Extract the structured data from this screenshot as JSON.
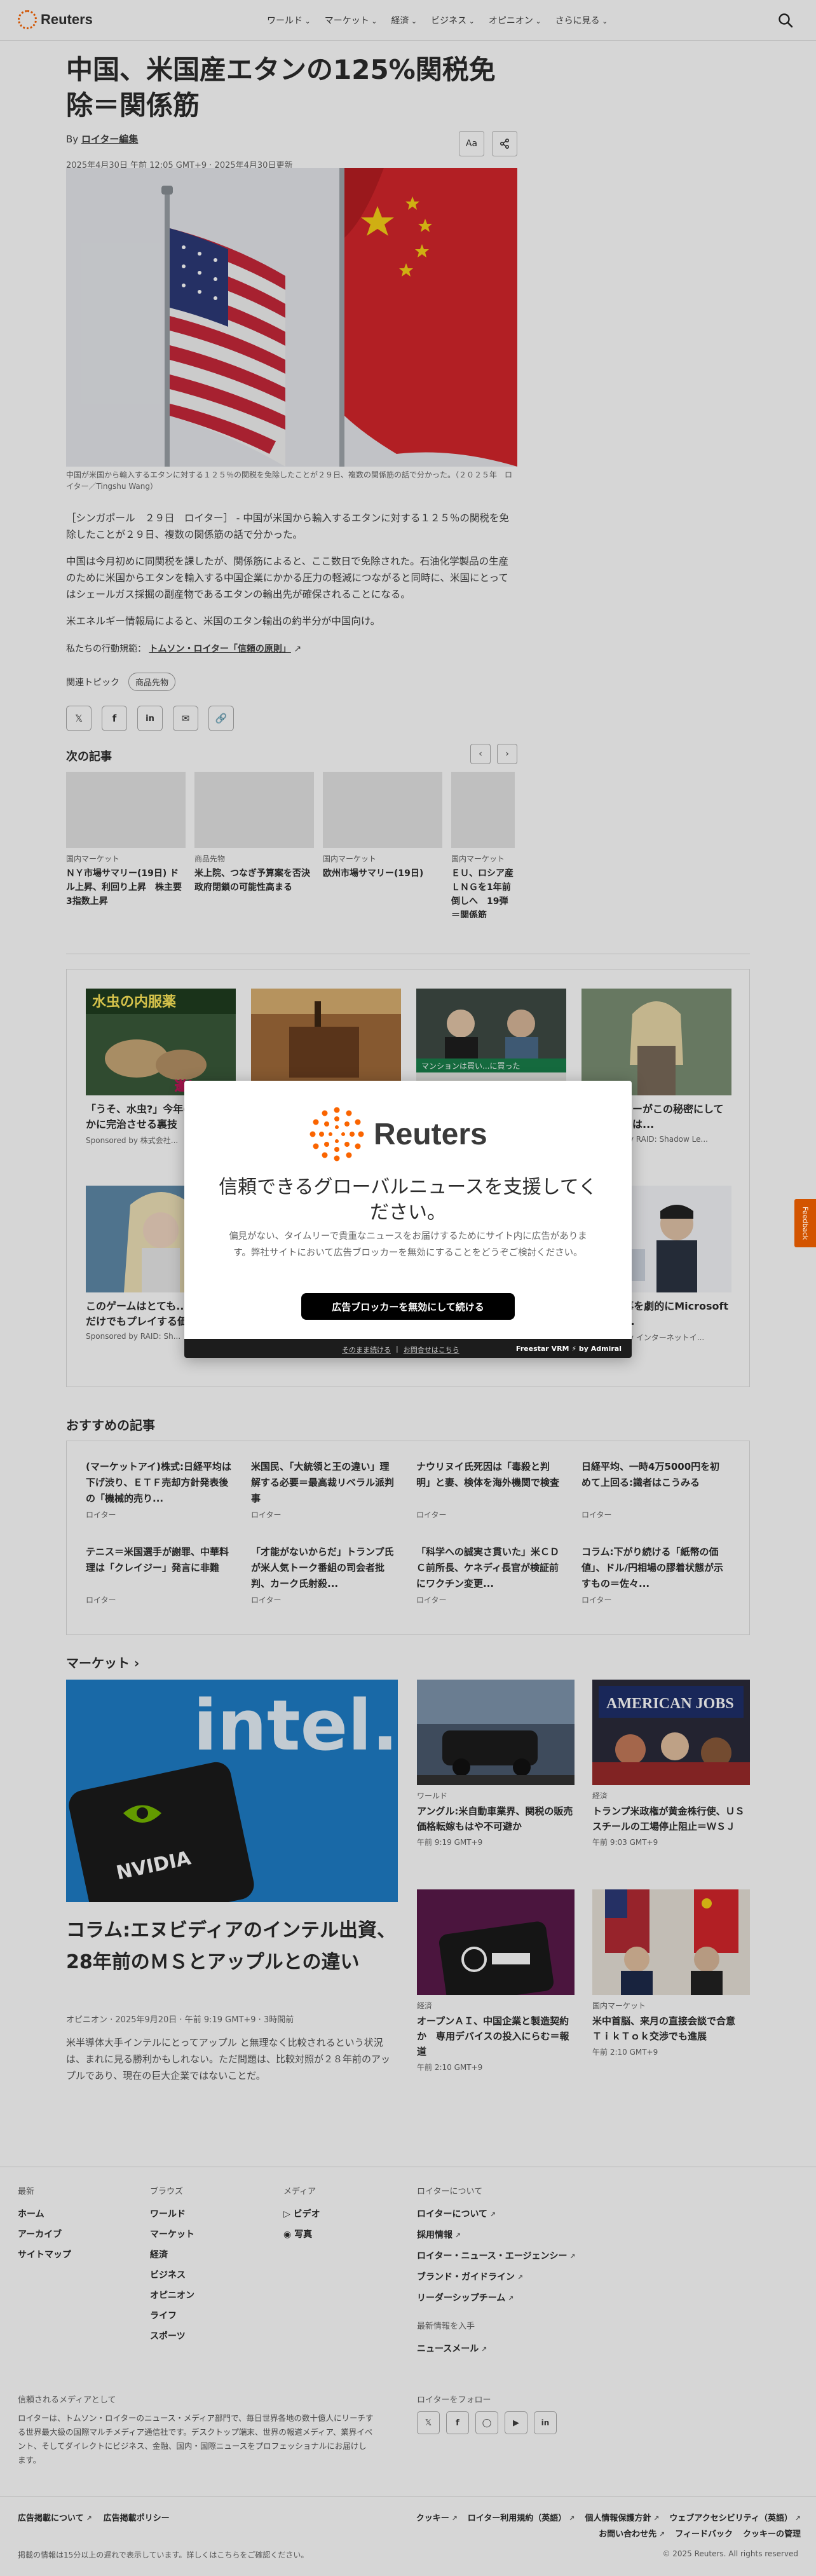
{
  "header": {
    "logo_text": "Reuters",
    "nav": [
      "ワールド",
      "マーケット",
      "経済",
      "ビジネス",
      "オピニオン",
      "さらに見る"
    ]
  },
  "article": {
    "headline": "中国、米国産エタンの125%関税免除＝関係筋",
    "byline_prefix": "By",
    "byline_author": "ロイター編集",
    "dateline": "2025年4月30日 午前 12:05 GMT+9 · 2025年4月30日更新",
    "text_size_label": "Aa",
    "caption": "中国が米国から輸入するエタンに対する１２５％の関税を免除したことが２９日、複数の関係筋の話で分かった。（２０２５年　ロイター／Tingshu Wang）",
    "paragraphs": [
      "［シンガポール　２９日　ロイター］ - 中国が米国から輸入するエタンに対する１２５％の関税を免除したことが２９日、複数の関係筋の話で分かった。",
      "中国は今月初めに同関税を課したが、関係筋によると、ここ数日で免除された。石油化学製品の生産のために米国からエタンを輸入する中国企業にかかる圧力の軽減につながると同時に、米国にとってはシェールガス採掘の副産物であるエタンの輸出先が確保されることになる。",
      "米エネルギー情報局によると、米国のエタン輸出の約半分が中国向け。"
    ],
    "trust_prefix": "私たちの行動規範：",
    "trust_link": "トムソン・ロイター「信頼の原則」",
    "topics_label": "関連トピック",
    "topic_pill": "商品先物"
  },
  "next_articles": {
    "title": "次の記事",
    "items": [
      {
        "kicker": "国内マーケット",
        "headline": "ＮＹ市場サマリー(19日) ドル上昇、利回り上昇　株主要3指数上昇"
      },
      {
        "kicker": "商品先物",
        "headline": "米上院、つなぎ予算案を否決　政府閉鎖の可能性高まる"
      },
      {
        "kicker": "国内マーケット",
        "headline": "欧州市場サマリー(19日)"
      },
      {
        "kicker": "国内マーケット",
        "headline": "ＥＵ、ロシア産ＬＮＧを1年前倒しへ　19弾＝関係筋"
      }
    ]
  },
  "sponsored": {
    "items": [
      {
        "title": "「うそ、水虫?」今年の夏、爽やかに完治させる裏技",
        "source": "Sponsored by 株式会社..."
      },
      {
        "title": "",
        "source": ""
      },
      {
        "title": "",
        "source": ""
      },
      {
        "title": "このゲーマーがこの秘密にしている理由とは...",
        "source": "Sponsored by RAID: Shadow Le..."
      },
      {
        "title": "このゲームはとても...で、見るだけでもプレイする価値がある!",
        "source": "Sponsored by RAID: Sh..."
      },
      {
        "title": "",
        "source": ""
      },
      {
        "title": "",
        "source": ""
      },
      {
        "title": "...フト仕事を劇的にMicrosoft 365導入...",
        "source": "Sponsored by インターネットイ..."
      }
    ],
    "img_texts": [
      "水虫の内服薬",
      "遂に",
      "マンションは買い...に買った"
    ]
  },
  "modal": {
    "logo_text": "Reuters",
    "title": "信頼できるグローバルニュースを支援してください。",
    "desc": "偏見がない、タイムリーで貴重なニュースをお届けするためにサイト内に広告があります。弊社サイトにおいて広告ブロッカーを無効にすることをどうぞご検討ください。",
    "button": "広告ブロッカーを無効にして続ける",
    "link_continue": "そのまま続ける",
    "link_help": "お問合せはこちら",
    "brand": "Freestar VRM ⚡ by Admiral"
  },
  "feedback_label": "Feedback",
  "recommended": {
    "title": "おすすめの記事",
    "items": [
      {
        "headline": "(マーケットアイ)株式:日経平均は下げ渋り、ＥＴＦ売却方針発表後の「機械的売り...",
        "source": "ロイター"
      },
      {
        "headline": "米国民、「大統領と王の違い」理解する必要＝最高裁リベラル派判事",
        "source": "ロイター"
      },
      {
        "headline": "ナウリヌイ氏死因は「毒殺と判明」と妻、検体を海外機関で検査",
        "source": "ロイター"
      },
      {
        "headline": "日経平均、一時4万5000円を初めて上回る:識者はこうみる",
        "source": "ロイター"
      },
      {
        "headline": "テニス＝米国選手が謝罪、中華料理は「クレイジー」発言に非難",
        "source": "ロイター"
      },
      {
        "headline": "「才能がないからだ」トランプ氏が米人気トーク番組の司会者批判、カーク氏射殺...",
        "source": "ロイター"
      },
      {
        "headline": "「科学への誠実さ貫いた」米ＣＤＣ前所長、ケネディ長官が検証前にワクチン変更...",
        "source": "ロイター"
      },
      {
        "headline": "コラム:下がり続ける「紙幣の価値」、ドル/円相場の膠着状態が示すもの＝佐々...",
        "source": "ロイター"
      }
    ]
  },
  "markets": {
    "title": "マーケット ›",
    "hero": {
      "headline": "コラム:エヌビディアのインテル出資、28年前のＭＳとアップルとの違い",
      "meta": "オピニオン · 2025年9月20日 · 午前 9:19 GMT+9 · 3時間前",
      "desc": "米半導体大手インテルにとってアップル と無理なく比較されるという状況は、まれに見る勝利かもしれない。ただ問題は、比較対照が２８年前のアップルであり、現在の巨大企業ではないことだ。",
      "img_text_intel": "intel.",
      "img_text_nvidia": "NVIDIA"
    },
    "cards": [
      {
        "kicker": "ワールド",
        "headline": "アングル:米自動車業界、関税の販売価格転嫁もはや不可避か",
        "time": "午前 9:19 GMT+9"
      },
      {
        "kicker": "経済",
        "headline": "トランプ米政権が黄金株行使、ＵＳスチールの工場停止阻止＝ＷＳＪ",
        "time": "午前 9:03 GMT+9"
      },
      {
        "kicker": "経済",
        "headline": "オープンＡＩ、中国企業と製造契約か　専用デバイスの投入にらむ＝報道",
        "time": "午前 2:10 GMT+9"
      },
      {
        "kicker": "国内マーケット",
        "headline": "米中首脳、来月の直接会談で合意　ＴｉｋＴｏｋ交渉でも進展",
        "time": "午前 2:10 GMT+9"
      }
    ],
    "img_text_jobs": "AMERICAN JOBS"
  },
  "footer": {
    "col1": {
      "title": "最新",
      "links": [
        "ホーム",
        "アーカイブ",
        "サイトマップ"
      ]
    },
    "col2": {
      "title": "ブラウズ",
      "links": [
        "ワールド",
        "マーケット",
        "経済",
        "ビジネス",
        "オピニオン",
        "ライフ",
        "スポーツ"
      ]
    },
    "col3": {
      "title": "メディア",
      "links": [
        "ビデオ",
        "写真"
      ]
    },
    "col4": {
      "title": "ロイターについて",
      "links": [
        "ロイターについて",
        "採用情報",
        "ロイター・ニュース・エージェンシー",
        "ブランド・ガイドライン",
        "リーダーシップチーム"
      ]
    },
    "col4b": {
      "title": "最新情報を入手",
      "links": [
        "ニュースメール"
      ]
    },
    "trusted": {
      "title": "信頼されるメディアとして",
      "text": "ロイターは、トムソン・ロイターのニュース・メディア部門で、毎日世界各地の数十億人にリーチする世界最大級の国際マルチメディア通信社です。デスクトップ端末、世界の報道メディア、業界イベント、そしてダイレクトにビジネス、金融、国内・国際ニュースをプロフェッショナルにお届けします。"
    },
    "follow_title": "ロイターをフォロー",
    "legal_left": [
      "広告掲載について",
      "広告掲載ポリシー"
    ],
    "legal_right": [
      "クッキー",
      "ロイター利用規約（英語）",
      "個人情報保護方針",
      "ウェブアクセシビリティ（英語）",
      "お問い合わせ先",
      "フィードバック",
      "クッキーの管理"
    ],
    "delay_note": "掲載の情報は15分以上の遅れで表示しています。詳しくはこちらをご確認ください。",
    "copyright": "© 2025 Reuters. All rights reserved"
  }
}
